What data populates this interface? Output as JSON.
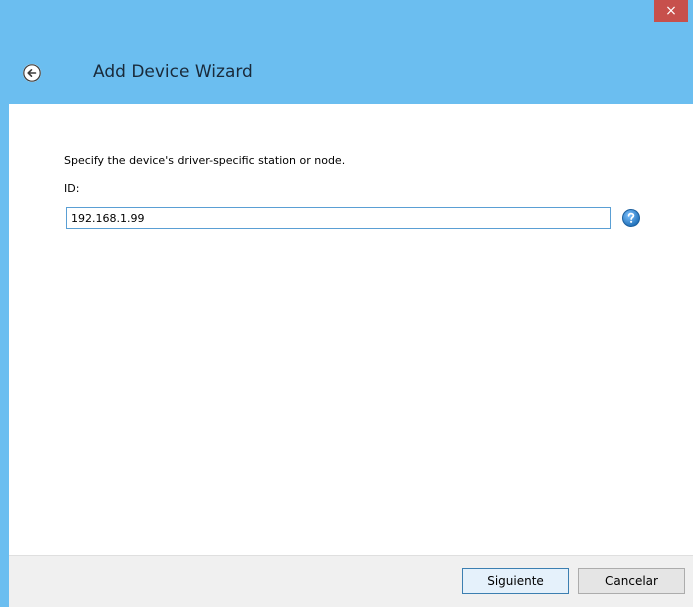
{
  "window": {
    "close_glyph": "×"
  },
  "header": {
    "title": "Add Device Wizard"
  },
  "main": {
    "instruction": "Specify the device's driver-specific station or node.",
    "id_label": "ID:",
    "id_value": "192.168.1.99"
  },
  "footer": {
    "next_label": "Siguiente",
    "cancel_label": "Cancelar"
  },
  "colors": {
    "titlebar": "#6bbef0",
    "close": "#c7504c",
    "input_border": "#5a9fd4",
    "help_icon": "#2f7fc6"
  },
  "icons": {
    "back": "back-arrow-icon",
    "help": "help-icon",
    "close": "close-icon"
  }
}
